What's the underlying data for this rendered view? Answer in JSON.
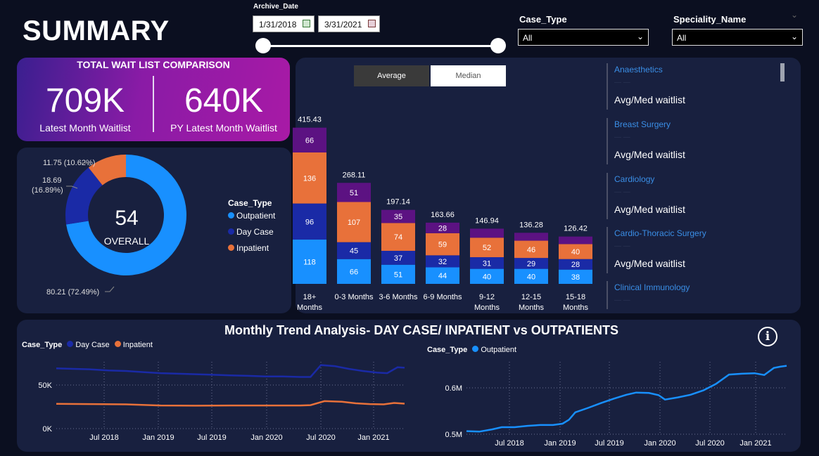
{
  "page": {
    "title": "SUMMARY"
  },
  "filters": {
    "archive_date": {
      "label": "Archive_Date",
      "start": "1/31/2018",
      "end": "3/31/2021"
    },
    "case_type": {
      "label": "Case_Type",
      "value": "All"
    },
    "speciality": {
      "label": "Speciality_Name",
      "value": "All"
    }
  },
  "kpi": {
    "title": "TOTAL WAIT LIST COMPARISON",
    "latest_value": "709K",
    "latest_label": "Latest Month Waitlist",
    "py_value": "640K",
    "py_label": "PY Latest Month Waitlist"
  },
  "donut": {
    "center_value": "54",
    "center_label": "OVERALL",
    "labels": {
      "inpatient_line": "11.75 (10.62%)",
      "daycase_line1": "18.69",
      "daycase_line2": "(16.89%)",
      "outpatient_line": "80.21 (72.49%)"
    },
    "legend_title": "Case_Type",
    "legend": [
      "Outpatient",
      "Day Case",
      "Inpatient"
    ]
  },
  "toggle": {
    "average": "Average",
    "median": "Median",
    "selected": "Average"
  },
  "specialities": {
    "sub_label": "Avg/Med waitlist",
    "items": [
      "Anaesthetics",
      "Breast Surgery",
      "Cardiology",
      "Cardio-Thoracic Surgery",
      "Clinical Immunology"
    ]
  },
  "trend": {
    "title": "Monthly Trend Analysis- DAY CASE/ INPATIENT vs OUTPATIENTS",
    "left_legend_title": "Case_Type",
    "left_legend": [
      "Day Case",
      "Inpatient"
    ],
    "right_legend_title": "Case_Type",
    "right_legend": [
      "Outpatient"
    ],
    "info_icon": "i"
  },
  "colors": {
    "outpatient": "#1890ff",
    "daycase": "#1a2aa6",
    "inpatient": "#e8713a",
    "other": "#5c1282",
    "panel": "#18203f"
  },
  "chart_data": [
    {
      "type": "pie",
      "title": "",
      "categories": [
        "Outpatient",
        "Day Case",
        "Inpatient"
      ],
      "values": [
        80.21,
        18.69,
        11.75
      ],
      "percents": [
        72.49,
        16.89,
        10.62
      ],
      "legend": "left of bars"
    },
    {
      "type": "bar",
      "stacked": true,
      "categories": [
        "18+ Months",
        "0-3 Months",
        "3-6 Months",
        "6-9 Months",
        "9-12 Months",
        "12-15 Months",
        "15-18 Months"
      ],
      "category_lines": [
        [
          "18+",
          "Months"
        ],
        [
          "0-3 Months"
        ],
        [
          "3-6 Months"
        ],
        [
          "6-9 Months"
        ],
        [
          "9-12",
          "Months"
        ],
        [
          "12-15",
          "Months"
        ],
        [
          "15-18",
          "Months"
        ]
      ],
      "totals": [
        415.43,
        268.11,
        197.14,
        163.66,
        146.94,
        136.28,
        126.42
      ],
      "series": [
        {
          "name": "Outpatient",
          "values": [
            118,
            66,
            51,
            44,
            40,
            40,
            38
          ],
          "labels": [
            "118",
            "66",
            "51",
            "44",
            "40",
            "40",
            "38"
          ]
        },
        {
          "name": "Day Case",
          "values": [
            96,
            45,
            37,
            32,
            31,
            29,
            28
          ],
          "labels": [
            "96",
            "45",
            "37",
            "32",
            "31",
            "29",
            "28"
          ]
        },
        {
          "name": "Inpatient",
          "values": [
            136,
            107,
            74,
            59,
            52,
            46,
            40
          ],
          "labels": [
            "136",
            "107",
            "74",
            "59",
            "52",
            "46",
            "40"
          ]
        },
        {
          "values": [
            66,
            51,
            35,
            28,
            24,
            21,
            20
          ],
          "labels": [
            "66",
            "51",
            "35",
            "28",
            "",
            "",
            ""
          ]
        }
      ]
    },
    {
      "type": "line",
      "x_ticks": [
        "Jul 2018",
        "Jan 2019",
        "Jul 2019",
        "Jan 2020",
        "Jul 2020",
        "Jan 2021"
      ],
      "y_ticks": [
        "0K",
        "50K"
      ],
      "ylim": [
        0,
        62000
      ],
      "series": [
        {
          "name": "Day Case",
          "points": [
            [
              0,
              56000
            ],
            [
              0.05,
              55500
            ],
            [
              0.1,
              55000
            ],
            [
              0.15,
              54000
            ],
            [
              0.2,
              53500
            ],
            [
              0.25,
              52500
            ],
            [
              0.3,
              51500
            ],
            [
              0.35,
              51000
            ],
            [
              0.4,
              50500
            ],
            [
              0.45,
              50000
            ],
            [
              0.5,
              49500
            ],
            [
              0.55,
              49000
            ],
            [
              0.6,
              48500
            ],
            [
              0.65,
              48500
            ],
            [
              0.7,
              48000
            ],
            [
              0.73,
              48000
            ],
            [
              0.76,
              59000
            ],
            [
              0.8,
              58000
            ],
            [
              0.84,
              55500
            ],
            [
              0.88,
              53500
            ],
            [
              0.92,
              52000
            ],
            [
              0.95,
              51500
            ],
            [
              0.98,
              57000
            ],
            [
              1,
              56500
            ]
          ]
        },
        {
          "name": "Inpatient",
          "points": [
            [
              0,
              23000
            ],
            [
              0.1,
              22800
            ],
            [
              0.2,
              22500
            ],
            [
              0.3,
              21500
            ],
            [
              0.4,
              21300
            ],
            [
              0.5,
              21500
            ],
            [
              0.6,
              21500
            ],
            [
              0.7,
              21500
            ],
            [
              0.73,
              21800
            ],
            [
              0.77,
              25500
            ],
            [
              0.82,
              25000
            ],
            [
              0.86,
              23500
            ],
            [
              0.9,
              22800
            ],
            [
              0.94,
              22500
            ],
            [
              0.97,
              23800
            ],
            [
              1,
              23200
            ]
          ]
        }
      ]
    },
    {
      "type": "line",
      "x_ticks": [
        "Jul 2018",
        "Jan 2019",
        "Jul 2019",
        "Jan 2020",
        "Jul 2020",
        "Jan 2021"
      ],
      "y_ticks": [
        "0.5M",
        "0.6M"
      ],
      "ylim": [
        0.495,
        0.66
      ],
      "series": [
        {
          "name": "Outpatient",
          "points": [
            [
              0,
              0.502
            ],
            [
              0.04,
              0.501
            ],
            [
              0.08,
              0.506
            ],
            [
              0.11,
              0.511
            ],
            [
              0.15,
              0.511
            ],
            [
              0.19,
              0.514
            ],
            [
              0.23,
              0.516
            ],
            [
              0.27,
              0.516
            ],
            [
              0.3,
              0.519
            ],
            [
              0.32,
              0.528
            ],
            [
              0.34,
              0.545
            ],
            [
              0.38,
              0.555
            ],
            [
              0.42,
              0.566
            ],
            [
              0.46,
              0.576
            ],
            [
              0.5,
              0.585
            ],
            [
              0.53,
              0.59
            ],
            [
              0.57,
              0.589
            ],
            [
              0.6,
              0.584
            ],
            [
              0.62,
              0.574
            ],
            [
              0.66,
              0.579
            ],
            [
              0.7,
              0.585
            ],
            [
              0.74,
              0.595
            ],
            [
              0.78,
              0.61
            ],
            [
              0.82,
              0.631
            ],
            [
              0.86,
              0.633
            ],
            [
              0.9,
              0.634
            ],
            [
              0.93,
              0.63
            ],
            [
              0.96,
              0.646
            ],
            [
              0.98,
              0.649
            ],
            [
              1,
              0.651
            ]
          ]
        }
      ]
    }
  ]
}
